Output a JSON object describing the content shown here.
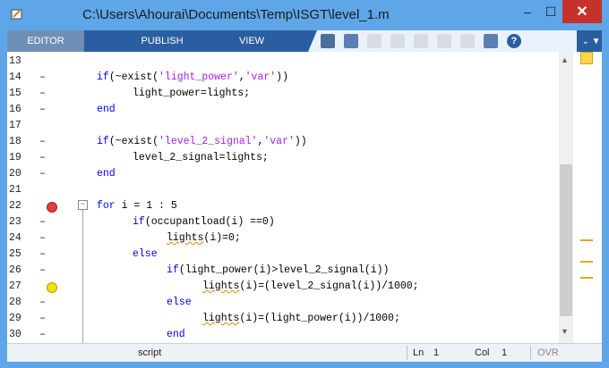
{
  "window": {
    "title": "C:\\Users\\Ahourai\\Documents\\Temp\\ISGT\\level_1.m",
    "minimize_symbol": "–",
    "maximize_symbol": "☐",
    "close_symbol": "✕"
  },
  "toolstrip": {
    "tabs": [
      "EDITOR",
      "PUBLISH",
      "VIEW"
    ],
    "active_tab": "EDITOR",
    "quick_access_icons": [
      "pencil-icon",
      "save-icon",
      "cut-icon",
      "copy-icon",
      "paste-icon",
      "undo-icon",
      "redo-icon",
      "switch-windows-icon",
      "help-icon"
    ],
    "overflow_symbol": "⌄ ▼"
  },
  "editor": {
    "lines": [
      {
        "n": "13",
        "mark": "",
        "bp": ""
      },
      {
        "n": "14",
        "mark": "–",
        "bp": ""
      },
      {
        "n": "15",
        "mark": "–",
        "bp": ""
      },
      {
        "n": "16",
        "mark": "–",
        "bp": ""
      },
      {
        "n": "17",
        "mark": "",
        "bp": ""
      },
      {
        "n": "18",
        "mark": "–",
        "bp": ""
      },
      {
        "n": "19",
        "mark": "–",
        "bp": ""
      },
      {
        "n": "20",
        "mark": "–",
        "bp": ""
      },
      {
        "n": "21",
        "mark": "",
        "bp": ""
      },
      {
        "n": "22",
        "mark": "",
        "bp": "red"
      },
      {
        "n": "23",
        "mark": "–",
        "bp": ""
      },
      {
        "n": "24",
        "mark": "–",
        "bp": ""
      },
      {
        "n": "25",
        "mark": "–",
        "bp": ""
      },
      {
        "n": "26",
        "mark": "–",
        "bp": ""
      },
      {
        "n": "27",
        "mark": "",
        "bp": "yellow"
      },
      {
        "n": "28",
        "mark": "–",
        "bp": ""
      },
      {
        "n": "29",
        "mark": "–",
        "bp": ""
      },
      {
        "n": "30",
        "mark": "–",
        "bp": ""
      }
    ],
    "code": {
      "l14": "if(~exist('light_power','var'))",
      "l15": "light_power=lights;",
      "l16": "end",
      "l18": "if(~exist('level_2_signal','var'))",
      "l19": "level_2_signal=lights;",
      "l20": "end",
      "l22": "for i = 1 : 5",
      "l23": "if(occupantload(i) ==0)",
      "l24": "lights(i)=0;",
      "l25": "else",
      "l26": "if(light_power(i)>level_2_signal(i))",
      "l27": "lights(i)=(level_2_signal(i))/1000;",
      "l28": "else",
      "l29": "lights(i)=(light_power(i))/1000;",
      "l30": "end"
    },
    "breakpoint_colors": {
      "red": "#e04040",
      "yellow": "#f5e000"
    }
  },
  "statusbar": {
    "mode": "script",
    "ln_label": "Ln",
    "ln_value": "1",
    "col_label": "Col",
    "col_value": "1",
    "ovr": "OVR"
  },
  "colors": {
    "titlebar": "#5fa6e8",
    "toolstrip": "#2a5ea0",
    "keyword": "#0000ff",
    "string": "#a020f0"
  }
}
